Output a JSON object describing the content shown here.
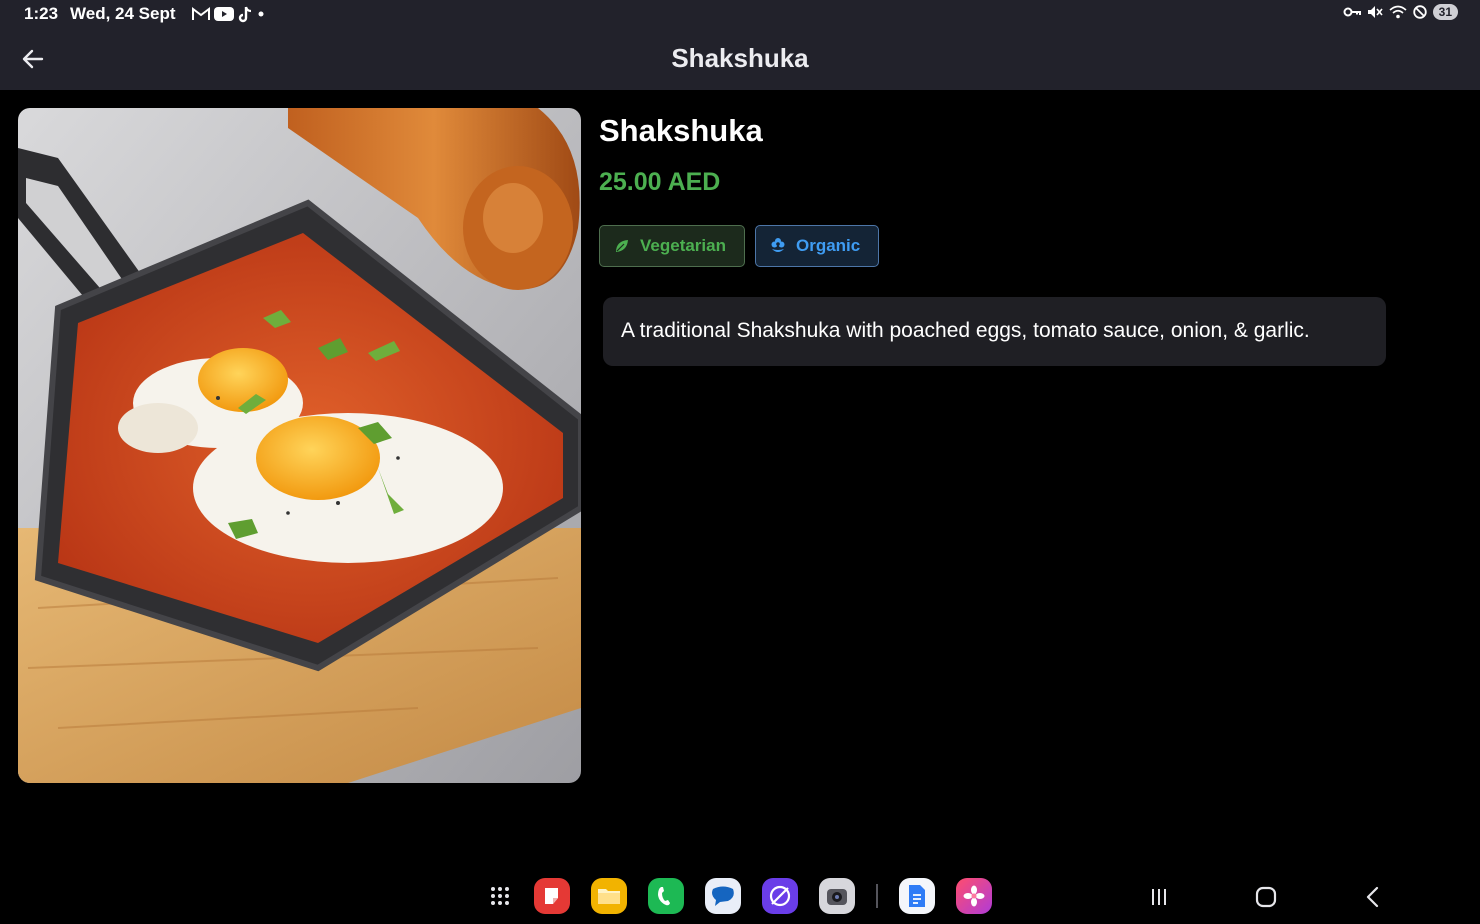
{
  "status_bar": {
    "time": "1:23",
    "date": "Wed, 24 Sept",
    "notification_icons": [
      "gmail-icon",
      "youtube-icon",
      "tiktok-icon",
      "more-dot-icon"
    ],
    "system_icons": [
      "vpn-key-icon",
      "mute-icon",
      "wifi-icon",
      "dnd-icon"
    ],
    "battery": "31"
  },
  "app_bar": {
    "title": "Shakshuka",
    "back_icon": "arrow-left-icon"
  },
  "dish": {
    "image_alt": "Shakshuka in a cast iron pan",
    "name": "Shakshuka",
    "price": "25.00 AED",
    "tags": [
      {
        "label": "Vegetarian",
        "icon": "leaf-icon",
        "color": "#4caf50"
      },
      {
        "label": "Organic",
        "icon": "flower-icon",
        "color": "#3f9cf2"
      }
    ],
    "description": "A traditional Shakshuka with poached eggs, tomato sauce, onion, & garlic."
  },
  "dock": {
    "apps": [
      "app-drawer-icon",
      "notes-app-icon",
      "files-app-icon",
      "phone-app-icon",
      "messages-app-icon",
      "browser-app-icon",
      "camera-app-icon",
      "docs-app-icon",
      "gallery-app-icon"
    ]
  },
  "navigation": [
    "recents-icon",
    "home-icon",
    "back-icon"
  ],
  "colors": {
    "bar_background": "#22222b",
    "background": "#000000",
    "price": "#4caf50",
    "vegetarian": "#4caf50",
    "organic": "#3f9cf2",
    "card": "#1f1f24"
  }
}
